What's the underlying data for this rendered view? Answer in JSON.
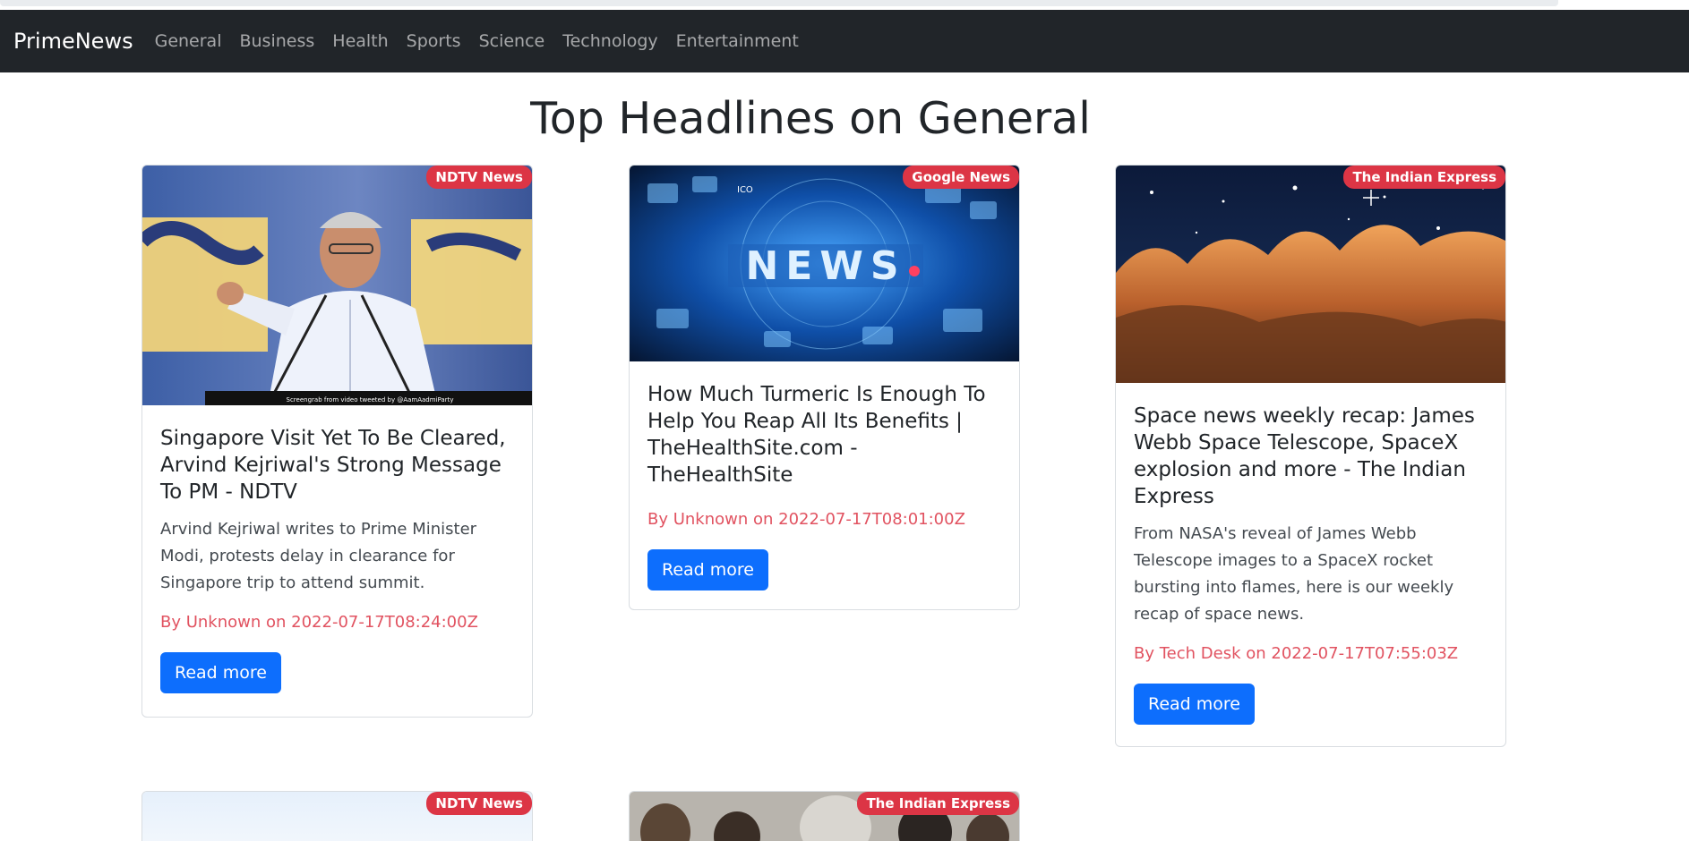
{
  "navbar": {
    "brand": "PrimeNews",
    "links": [
      "General",
      "Business",
      "Health",
      "Sports",
      "Science",
      "Technology",
      "Entertainment"
    ]
  },
  "page": {
    "heading": "Top Headlines on General"
  },
  "articles": [
    {
      "source": "NDTV News",
      "title": "Singapore Visit Yet To Be Cleared, Arvind Kejriwal's Strong Message To PM - NDTV",
      "description": "Arvind Kejriwal writes to Prime Minister Modi, protests delay in clearance for Singapore trip to attend summit.",
      "meta": "By Unknown on 2022-07-17T08:24:00Z",
      "button": "Read more",
      "caption": "Screengrab from video tweeted by @AamAadmiParty"
    },
    {
      "source": "Google News",
      "title": "How Much Turmeric Is Enough To Help You Reap All Its Benefits | TheHealthSite.com - TheHealthSite",
      "meta": "By Unknown on 2022-07-17T08:01:00Z",
      "button": "Read more",
      "image_text": "NEWS",
      "image_small_text": "ICO"
    },
    {
      "source": "The Indian Express",
      "title": "Space news weekly recap: James Webb Space Telescope, SpaceX explosion and more - The Indian Express",
      "description": "From NASA's reveal of James Webb Telescope images to a SpaceX rocket bursting into flames, here is our weekly recap of space news.",
      "meta": "By Tech Desk on 2022-07-17T07:55:03Z",
      "button": "Read more"
    },
    {
      "source": "NDTV News"
    },
    {
      "source": "The Indian Express"
    }
  ],
  "colors": {
    "navbar": "#212529",
    "badge": "#dc3545",
    "button": "#0d6efd",
    "meta": "#dc3545"
  }
}
